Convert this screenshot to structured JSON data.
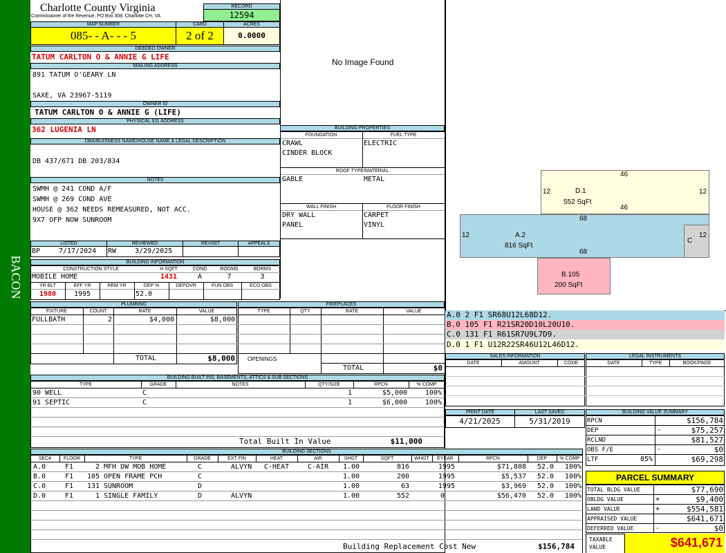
{
  "side_label": "BACON",
  "county": {
    "name": "Charlotte County Virginia",
    "address": "Commissioner of the Revenue, PO Box 308, Charlotte CH, VA"
  },
  "record": {
    "label": "RECORD",
    "value": "12594"
  },
  "map": {
    "label": "MAP NUMBER",
    "value": "085- - A- - - 5"
  },
  "card": {
    "label": "CARD",
    "value": "2 of 2"
  },
  "acres": {
    "label": "ACRES",
    "value": "0.0000"
  },
  "deeded_owner": {
    "label": "DEEDED OWNER",
    "value": "TATUM CARLTON O & ANNIE G  LIFE"
  },
  "mailing": {
    "label": "MAILING ADDRESS",
    "line1": "891 TATUM O'GEARY LN",
    "line2": "",
    "line3": "SAXE, VA 23967-5119"
  },
  "owner_id": {
    "label": "OWNER ID",
    "value": "TATUM CARLTON O & ANNIE G (LIFE)"
  },
  "physical": {
    "label": "PHYSICAL 911 ADDRESS",
    "value": "362 LUGENIA LN"
  },
  "dba": {
    "label": "DBA/BUISNESS NAME/HOUSE NAME & LEGAL DESCRIPTION",
    "value": "DB 437/671 DB 203/834"
  },
  "notes": {
    "label": "NOTES",
    "lines": [
      "SWMH @ 241 COND A/F",
      "SWMH @ 269 COND AVE",
      "HOUSE @ 362 NEEDS REMEASURED, NOT ACC.",
      "9X7 OFP NOW SUNROOM"
    ]
  },
  "listed": {
    "label": "LISTED",
    "initials": "BP",
    "date": "7/17/2024"
  },
  "reviewed": {
    "label": "REVIEWED",
    "initials": "RW",
    "date": "3/29/2025"
  },
  "revisit": {
    "label": "REVISIT"
  },
  "appeals": {
    "label": "APPEALS"
  },
  "building_info": {
    "label": "BUILDING INFORMATION",
    "h_construction": "CONSTRUCTION STYLE",
    "h_hsqft": "H SQFT",
    "h_cond": "COND",
    "h_rooms": "ROOMS",
    "h_bdrms": "BDRMS",
    "construction": "MOBILE HOME",
    "hsqft": "1431",
    "cond": "A",
    "rooms": "7",
    "bdrms": "3",
    "h_yrblt": "YR BLT",
    "h_effyr": "EFF YR",
    "h_remyr": "REM YR",
    "h_dep": "DEP %",
    "h_depovr": "DEPOVR",
    "h_funobs": "FUN OBS",
    "h_ecoobs": "ECO OBS",
    "yrblt": "1980",
    "effyr": "1995",
    "remyr": "",
    "dep": "52.0",
    "depovr": "",
    "funobs": "",
    "ecoobs": ""
  },
  "image": {
    "text": "No Image Found"
  },
  "building_props": {
    "label": "BUILDING PROPERTIES",
    "h_foundation": "FOUNDATION",
    "h_fuel": "FUEL TYPE",
    "foundation1": "CRAWL",
    "foundation2": "CINDER BLOCK",
    "fuel": "ELECTRIC",
    "h_roof": "ROOF TYPE/MATERIAL",
    "roof_type": "GABLE",
    "roof_material": "METAL",
    "h_wall": "WALL FINISH",
    "h_floor": "FLOOR FINISH",
    "wall1": "DRY WALL",
    "wall2": "PANEL",
    "floor1": "CARPET",
    "floor2": "VINYL"
  },
  "sketch": {
    "d_label": "D.1",
    "d_area": "552 SqFt",
    "d_top": "46",
    "d_bottom": "46",
    "d_left": "12",
    "d_right": "12",
    "a_label": "A.2",
    "a_area": "816 SqFt",
    "a_top": "68",
    "a_bottom": "68",
    "a_left": "12",
    "a_right": "12",
    "c_label": "C",
    "b_label": "B.105",
    "b_area": "200 SqFt",
    "colors": {
      "d": "#ffffe0",
      "a": "#add8e6",
      "c": "#d3d3d3",
      "b": "#ffb6c1"
    }
  },
  "sketch_legend": [
    {
      "text": "A.0  2    F1   SR68U12L68D12.",
      "color": "#add8e6"
    },
    {
      "text": "B.0  105  F1   R21SR20D10L20U10.",
      "color": "#ffb6c1"
    },
    {
      "text": "C.0  131  F1   R61SR7U9L7D9.",
      "color": "#d3d3d3"
    },
    {
      "text": "D.0  1    F1   U12R22SR46U12L46D12.",
      "color": "#ffffe0"
    }
  ],
  "plumbing": {
    "label": "PLUMBING",
    "h_fixture": "FIXTURE",
    "h_count": "COUNT",
    "h_rate": "RATE",
    "h_value": "VALUE",
    "rows": [
      {
        "fixture": "FULLBATH",
        "count": "2",
        "rate": "$4,000",
        "value": "$8,000"
      }
    ],
    "total_label": "TOTAL",
    "total": "$8,000"
  },
  "fireplaces": {
    "label": "FIREPLACES",
    "h_type": "TYPE",
    "h_qty": "QTY",
    "h_rate": "RATE",
    "h_value": "VALUE",
    "openings": "OPENINGS",
    "total_label": "TOTAL",
    "total": "$0"
  },
  "sales": {
    "label": "SALES INFORMATION",
    "h_date": "DATE",
    "h_amount": "AMOUNT",
    "h_code": "CODE"
  },
  "legal": {
    "label": "LEGAL INSTRUMENTS",
    "h_date": "DATE",
    "h_type": "TYPE",
    "h_bookpage": "BOOK/PAGE"
  },
  "built_ins": {
    "label": "BUILDING BUILT INS, BASEMENTS, ATTICS & SUB SECTIONS",
    "h_type": "TYPE",
    "h_grade": "GRADE",
    "h_notes": "NOTES",
    "h_qty": "QTY/SIZE",
    "h_rpcn": "RPCN",
    "h_comp": "% COMP",
    "rows": [
      {
        "type": "90 WELL",
        "grade": "C",
        "qty": "1",
        "rpcn": "$5,000",
        "comp": "100%"
      },
      {
        "type": "91 SEPTIC",
        "grade": "C",
        "qty": "1",
        "rpcn": "$6,000",
        "comp": "100%"
      }
    ],
    "total_label": "Total Built In Value",
    "total": "$11,000"
  },
  "print": {
    "label": "PRINT DATE",
    "value": "4/21/2025"
  },
  "saved": {
    "label": "LAST SAVED",
    "value": "5/31/2019"
  },
  "value_summary": {
    "label": "BUILDING VALUE SUMMARY",
    "rows": [
      {
        "label": "RPCN",
        "sign": "",
        "pct": "",
        "value": "$156,784"
      },
      {
        "label": "DEP",
        "sign": "-",
        "pct": "",
        "value": "$75,257"
      },
      {
        "label": "RCLND",
        "sign": "",
        "pct": "",
        "value": "$81,527"
      },
      {
        "label": "OBS F/E",
        "sign": "-",
        "pct": "",
        "value": "$0"
      },
      {
        "label": "LTF",
        "sign": "",
        "pct": "85%",
        "value": "$69,298"
      }
    ]
  },
  "sections": {
    "label": "BUILDING SECTIONS",
    "h_sec": "SEC#",
    "h_floor": "FLOOR",
    "h_type": "TYPE",
    "h_grade": "GRADE",
    "h_extfin": "EXT FIN",
    "h_heat": "HEAT",
    "h_air": "AIR",
    "h_shgt": "SHGT",
    "h_sqft": "SQFT",
    "h_whgt": "WHGT",
    "h_eyear": "EYEAR",
    "h_rpcn": "RPCN",
    "h_dep": "DEP",
    "h_comp": "% COMP",
    "rows": [
      {
        "sec": "A.0",
        "floor": "F1",
        "code": "2",
        "type": "MFH DW MOB HOME",
        "grade": "C",
        "extfin": "ALVYN",
        "heat": "C-HEAT",
        "air": "C-AIR",
        "shgt": "1.00",
        "sqft": "816",
        "whgt": "",
        "eyear": "1995",
        "rpcn": "$71,808",
        "dep": "52.0",
        "comp": "100%"
      },
      {
        "sec": "B.0",
        "floor": "F1",
        "code": "105",
        "type": "OPEN FRAME PCH",
        "grade": "C",
        "extfin": "",
        "heat": "",
        "air": "",
        "shgt": "1.00",
        "sqft": "200",
        "whgt": "",
        "eyear": "1995",
        "rpcn": "$5,537",
        "dep": "52.0",
        "comp": "100%"
      },
      {
        "sec": "C.0",
        "floor": "F1",
        "code": "131",
        "type": "SUNROOM",
        "grade": "D",
        "extfin": "",
        "heat": "",
        "air": "",
        "shgt": "1.00",
        "sqft": "63",
        "whgt": "",
        "eyear": "1995",
        "rpcn": "$3,969",
        "dep": "52.0",
        "comp": "100%"
      },
      {
        "sec": "D.0",
        "floor": "F1",
        "code": "1",
        "type": "SINGLE FAMILY",
        "grade": "D",
        "extfin": "ALVYN",
        "heat": "",
        "air": "",
        "shgt": "1.00",
        "sqft": "552",
        "whgt": "",
        "eyear": "0",
        "rpcn": "$56,470",
        "dep": "52.0",
        "comp": "100%"
      }
    ],
    "total_label": "Building Replacement Cost New",
    "total": "$156,784"
  },
  "parcel": {
    "label": "PARCEL SUMMARY",
    "rows": [
      {
        "label": "TOTAL BLDG VALUE",
        "sign": "",
        "value": "$77,690"
      },
      {
        "label": "OBLDG VALUE",
        "sign": "+",
        "value": "$9,400"
      },
      {
        "label": "LAND VALUE",
        "sign": "+",
        "value": "$554,581"
      },
      {
        "label": "APPRAISED VALUE",
        "sign": "",
        "value": "$641,671"
      },
      {
        "label": "DEFERRED VALUE",
        "sign": "-",
        "value": "$0"
      }
    ],
    "taxable_label": "TAXABLE VALUE",
    "taxable": "$641,671"
  }
}
